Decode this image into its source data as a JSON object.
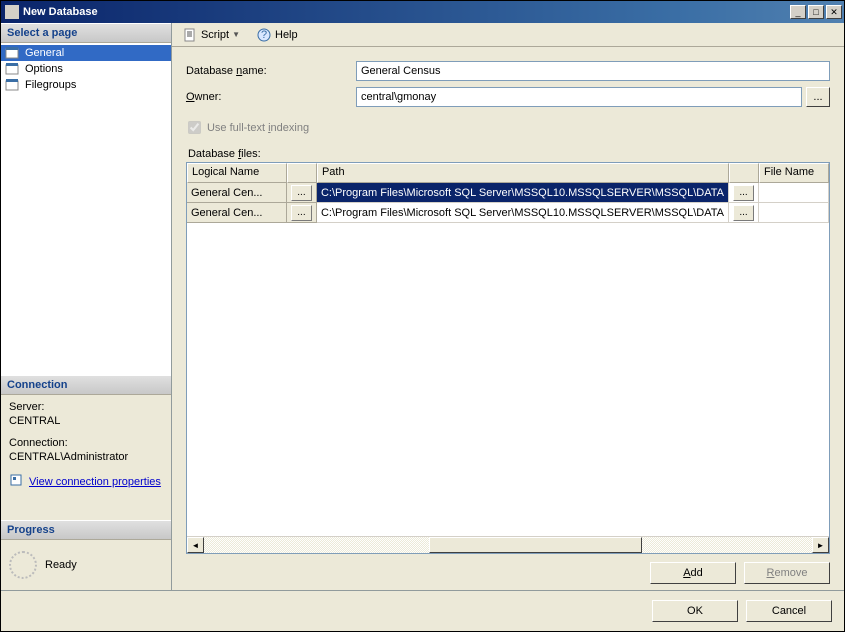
{
  "window": {
    "title": "New Database"
  },
  "sidebar": {
    "select_page_header": "Select a page",
    "pages": [
      {
        "label": "General",
        "selected": true
      },
      {
        "label": "Options",
        "selected": false
      },
      {
        "label": "Filegroups",
        "selected": false
      }
    ],
    "connection_header": "Connection",
    "connection": {
      "server_label": "Server:",
      "server_value": "CENTRAL",
      "connection_label": "Connection:",
      "connection_value": "CENTRAL\\Administrator",
      "view_properties": "View connection properties"
    },
    "progress_header": "Progress",
    "progress_status": "Ready"
  },
  "toolbar": {
    "script_label": "Script",
    "help_label": "Help"
  },
  "form": {
    "dbname_label_pre": "Database ",
    "dbname_label_u": "n",
    "dbname_label_post": "ame:",
    "dbname_value": "General Census",
    "owner_label_u": "O",
    "owner_label_post": "wner:",
    "owner_value": "central\\gmonay",
    "fulltext_label_pre": "Use full-text ",
    "fulltext_label_u": "i",
    "fulltext_label_post": "ndexing",
    "files_label_pre": "Database ",
    "files_label_u": "f",
    "files_label_post": "iles:"
  },
  "grid": {
    "columns": {
      "logical": "Logical Name",
      "path": "Path",
      "filename": "File Name"
    },
    "rows": [
      {
        "logical": "General Cen...",
        "path": "C:\\Program Files\\Microsoft SQL Server\\MSSQL10.MSSQLSERVER\\MSSQL\\DATA",
        "filename": "",
        "selected": true
      },
      {
        "logical": "General Cen...",
        "path": "C:\\Program Files\\Microsoft SQL Server\\MSSQL10.MSSQLSERVER\\MSSQL\\DATA",
        "filename": "",
        "selected": false
      }
    ],
    "browse_label": "...",
    "add_label_u": "A",
    "add_label_post": "dd",
    "remove_label_u": "R",
    "remove_label_post": "emove"
  },
  "footer": {
    "ok_label": "OK",
    "cancel_label": "Cancel"
  }
}
